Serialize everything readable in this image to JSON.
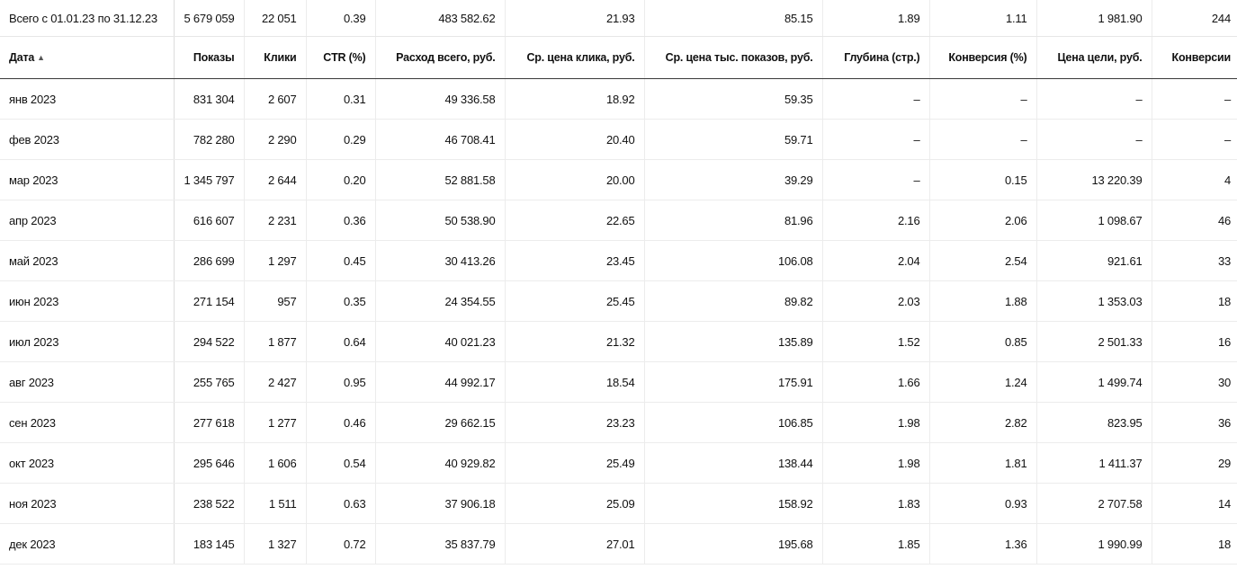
{
  "totals": {
    "label": "Всего с 01.01.23 по 31.12.23",
    "values": [
      "5 679 059",
      "22 051",
      "0.39",
      "483 582.62",
      "21.93",
      "85.15",
      "1.89",
      "1.11",
      "1 981.90",
      "244"
    ]
  },
  "headers": {
    "date": "Дата",
    "date_sort_icon": "▲",
    "cols": [
      "Показы",
      "Клики",
      "CTR (%)",
      "Расход всего, руб.",
      "Ср. цена клика, руб.",
      "Ср. цена тыс. показов, руб.",
      "Глубина (стр.)",
      "Конверсия (%)",
      "Цена цели, руб.",
      "Конверсии"
    ]
  },
  "rows": [
    {
      "date": "янв 2023",
      "cells": [
        "831 304",
        "2 607",
        "0.31",
        "49 336.58",
        "18.92",
        "59.35",
        "–",
        "–",
        "–",
        "–"
      ]
    },
    {
      "date": "фев 2023",
      "cells": [
        "782 280",
        "2 290",
        "0.29",
        "46 708.41",
        "20.40",
        "59.71",
        "–",
        "–",
        "–",
        "–"
      ]
    },
    {
      "date": "мар 2023",
      "cells": [
        "1 345 797",
        "2 644",
        "0.20",
        "52 881.58",
        "20.00",
        "39.29",
        "–",
        "0.15",
        "13 220.39",
        "4"
      ]
    },
    {
      "date": "апр 2023",
      "cells": [
        "616 607",
        "2 231",
        "0.36",
        "50 538.90",
        "22.65",
        "81.96",
        "2.16",
        "2.06",
        "1 098.67",
        "46"
      ]
    },
    {
      "date": "май 2023",
      "cells": [
        "286 699",
        "1 297",
        "0.45",
        "30 413.26",
        "23.45",
        "106.08",
        "2.04",
        "2.54",
        "921.61",
        "33"
      ]
    },
    {
      "date": "июн 2023",
      "cells": [
        "271 154",
        "957",
        "0.35",
        "24 354.55",
        "25.45",
        "89.82",
        "2.03",
        "1.88",
        "1 353.03",
        "18"
      ]
    },
    {
      "date": "июл 2023",
      "cells": [
        "294 522",
        "1 877",
        "0.64",
        "40 021.23",
        "21.32",
        "135.89",
        "1.52",
        "0.85",
        "2 501.33",
        "16"
      ]
    },
    {
      "date": "авг 2023",
      "cells": [
        "255 765",
        "2 427",
        "0.95",
        "44 992.17",
        "18.54",
        "175.91",
        "1.66",
        "1.24",
        "1 499.74",
        "30"
      ]
    },
    {
      "date": "сен 2023",
      "cells": [
        "277 618",
        "1 277",
        "0.46",
        "29 662.15",
        "23.23",
        "106.85",
        "1.98",
        "2.82",
        "823.95",
        "36"
      ]
    },
    {
      "date": "окт 2023",
      "cells": [
        "295 646",
        "1 606",
        "0.54",
        "40 929.82",
        "25.49",
        "138.44",
        "1.98",
        "1.81",
        "1 411.37",
        "29"
      ]
    },
    {
      "date": "ноя 2023",
      "cells": [
        "238 522",
        "1 511",
        "0.63",
        "37 906.18",
        "25.09",
        "158.92",
        "1.83",
        "0.93",
        "2 707.58",
        "14"
      ]
    },
    {
      "date": "дек 2023",
      "cells": [
        "183 145",
        "1 327",
        "0.72",
        "35 837.79",
        "27.01",
        "195.68",
        "1.85",
        "1.36",
        "1 990.99",
        "18"
      ]
    }
  ]
}
